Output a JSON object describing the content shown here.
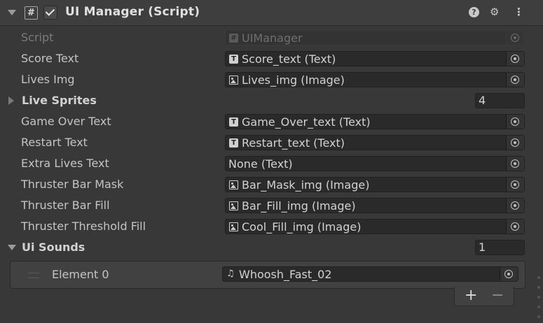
{
  "component": {
    "title": "UI Manager (Script)",
    "icons": {
      "help": "?",
      "presets": "⚙",
      "more": "⋮"
    }
  },
  "fields": [
    {
      "label": "Script",
      "value": "UIManager",
      "icon": "script-asset-icon",
      "disabled": true
    },
    {
      "label": "Score Text",
      "value": "Score_text (Text)",
      "icon": "text-icon"
    },
    {
      "label": "Lives Img",
      "value": "Lives_img (Image)",
      "icon": "image-icon"
    }
  ],
  "live_sprites": {
    "label": "Live Sprites",
    "count": "4"
  },
  "fields2": [
    {
      "label": "Game Over Text",
      "value": "Game_Over_text (Text)",
      "icon": "text-icon"
    },
    {
      "label": "Restart Text",
      "value": "Restart_text (Text)",
      "icon": "text-icon"
    },
    {
      "label": "Extra Lives Text",
      "value": "None (Text)",
      "icon": ""
    },
    {
      "label": "Thruster Bar Mask",
      "value": "Bar_Mask_img (Image)",
      "icon": "image-icon"
    },
    {
      "label": "Thruster Bar Fill",
      "value": "Bar_Fill_img (Image)",
      "icon": "image-icon"
    },
    {
      "label": "Thruster Threshold Fill",
      "value": "Cool_Fill_img (Image)",
      "icon": "image-icon"
    }
  ],
  "ui_sounds": {
    "label": "Ui Sounds",
    "count": "1",
    "elements": [
      {
        "label": "Element 0",
        "value": "Whoosh_Fast_02",
        "icon": "audio-clip-icon"
      }
    ],
    "add": "+",
    "remove": "−"
  }
}
